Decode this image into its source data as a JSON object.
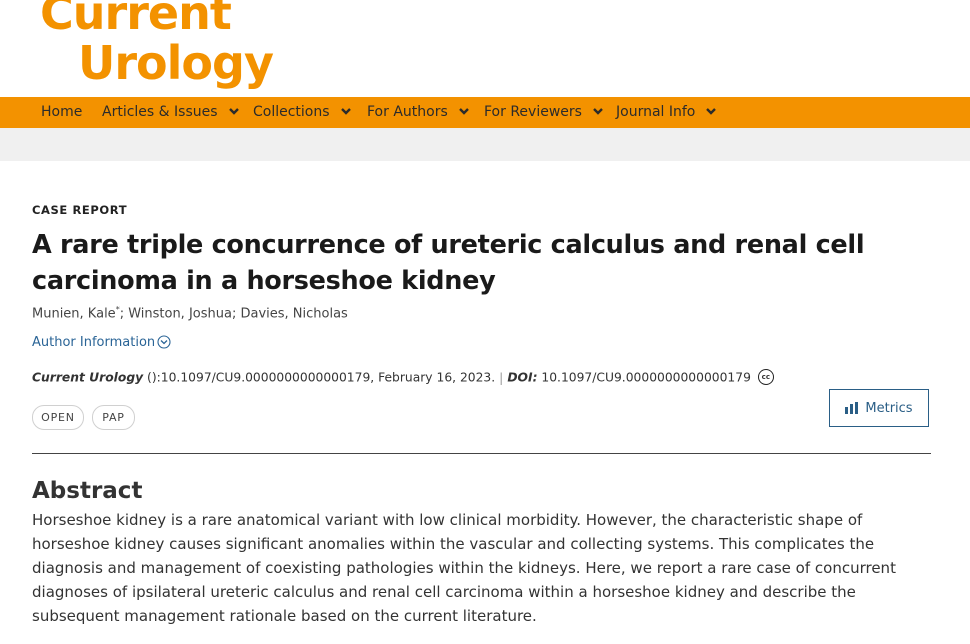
{
  "logo": {
    "line1": "Current",
    "line2": "Urology"
  },
  "nav": {
    "items": [
      {
        "label": "Home",
        "dropdown": false
      },
      {
        "label": "Articles & Issues",
        "dropdown": true
      },
      {
        "label": "Collections",
        "dropdown": true
      },
      {
        "label": "For Authors",
        "dropdown": true
      },
      {
        "label": "For Reviewers",
        "dropdown": true
      },
      {
        "label": "Journal Info",
        "dropdown": true
      }
    ]
  },
  "article": {
    "type": "CASE REPORT",
    "title": "A rare triple concurrence of ureteric calculus and renal cell carcinoma in a horseshoe kidney",
    "authors": [
      {
        "name": "Munien, Kale",
        "mark": "*"
      },
      {
        "name": "Winston, Joshua",
        "mark": ""
      },
      {
        "name": "Davies, Nicholas",
        "mark": ""
      }
    ],
    "author_info_link": "Author Information",
    "citation": {
      "journal": "Current Urology",
      "ref": " ():10.1097/CU9.0000000000000179, February 16, 2023.",
      "separator": "|",
      "doi_label": "DOI:",
      "doi": "10.1097/CU9.0000000000000179",
      "license_icon": "creative-commons-icon",
      "license_text": "cc"
    },
    "badges": [
      "OPEN",
      "PAP"
    ],
    "metrics_label": "Metrics"
  },
  "abstract": {
    "heading": "Abstract",
    "text": "Horseshoe kidney is a rare anatomical variant with low clinical morbidity. However, the characteristic shape of horseshoe kidney causes significant anomalies within the vascular and collecting systems. This complicates the diagnosis and management of coexisting pathologies within the kidneys. Here, we report a rare case of concurrent diagnoses of ipsilateral ureteric calculus and renal cell carcinoma within a horseshoe kidney and describe the subsequent management rationale based on the current literature."
  },
  "colors": {
    "brand_orange": "#f39200",
    "link_blue": "#2a6496",
    "metrics_blue": "#2a5e86",
    "subheader_gray": "#f0f0f0"
  }
}
